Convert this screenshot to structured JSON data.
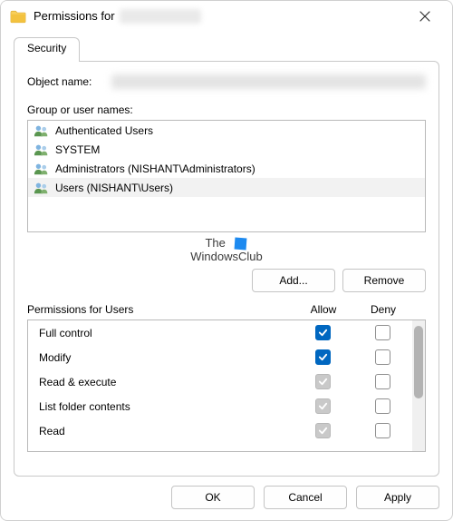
{
  "title_prefix": "Permissions for",
  "tabs": {
    "security": "Security"
  },
  "object_name_label": "Object name:",
  "group_label": "Group or user names:",
  "principals": [
    {
      "label": "Authenticated Users"
    },
    {
      "label": "SYSTEM"
    },
    {
      "label": "Administrators (NISHANT\\Administrators)"
    },
    {
      "label": "Users (NISHANT\\Users)"
    }
  ],
  "watermark_line1": "The",
  "watermark_line2": "WindowsClub",
  "buttons": {
    "add": "Add...",
    "remove": "Remove",
    "ok": "OK",
    "cancel": "Cancel",
    "apply": "Apply"
  },
  "perm_header_label": "Permissions for Users",
  "perm_col_allow": "Allow",
  "perm_col_deny": "Deny",
  "permissions": [
    {
      "name": "Full control",
      "allow": "checked",
      "deny": "unchecked"
    },
    {
      "name": "Modify",
      "allow": "checked",
      "deny": "unchecked"
    },
    {
      "name": "Read & execute",
      "allow": "dis-checked",
      "deny": "unchecked"
    },
    {
      "name": "List folder contents",
      "allow": "dis-checked",
      "deny": "unchecked"
    },
    {
      "name": "Read",
      "allow": "dis-checked",
      "deny": "unchecked"
    }
  ]
}
